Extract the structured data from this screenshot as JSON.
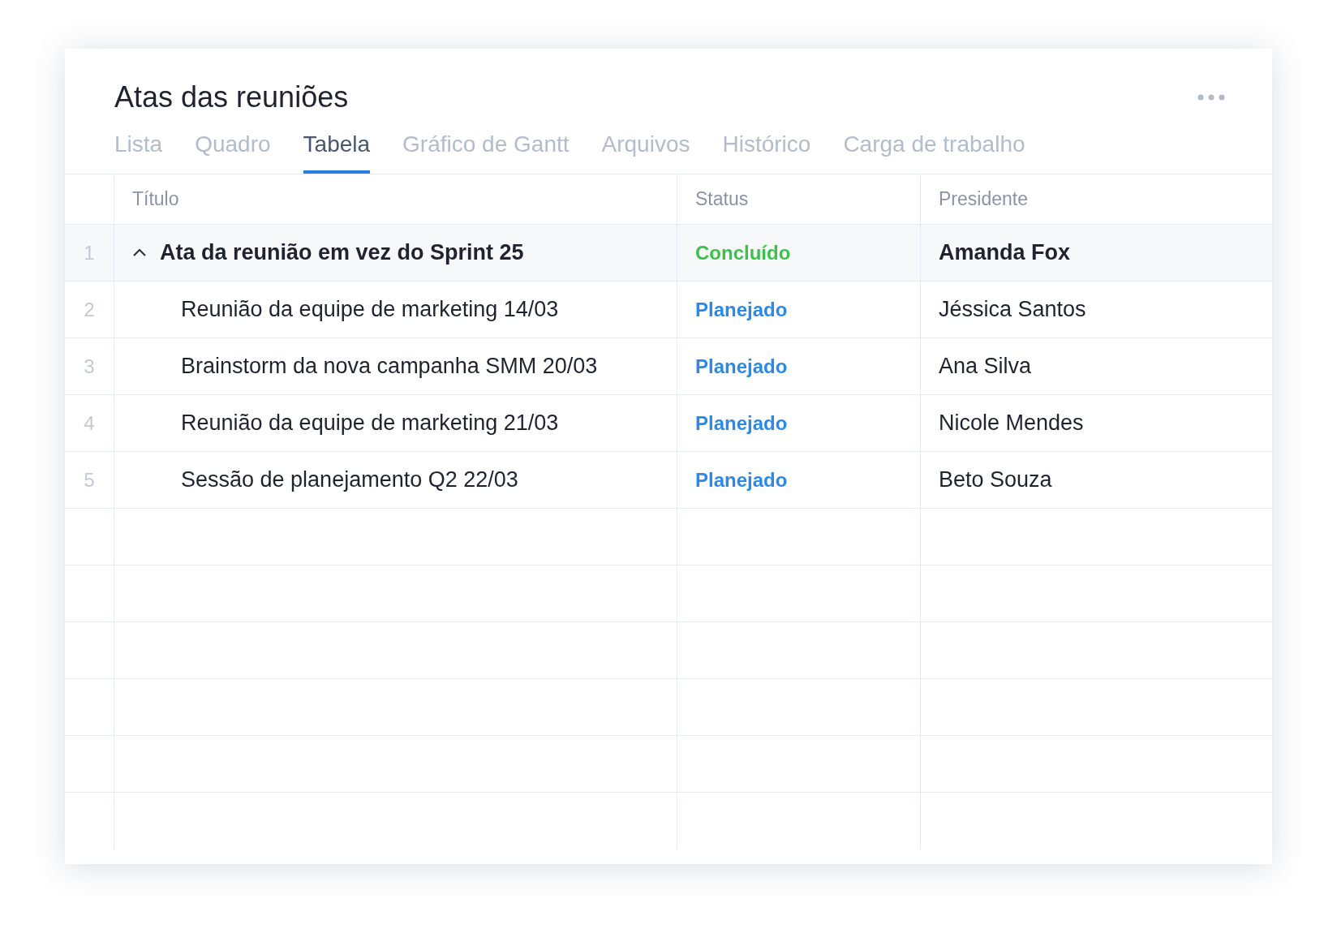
{
  "title": "Atas das reuniões",
  "tabs": [
    {
      "label": "Lista",
      "selected": false
    },
    {
      "label": "Quadro",
      "selected": false
    },
    {
      "label": "Tabela",
      "selected": true
    },
    {
      "label": "Gráfico de Gantt",
      "selected": false
    },
    {
      "label": "Arquivos",
      "selected": false
    },
    {
      "label": "Histórico",
      "selected": false
    },
    {
      "label": "Carga de trabalho",
      "selected": false
    }
  ],
  "table": {
    "columns": [
      "Título",
      "Status",
      "Presidente"
    ],
    "rows": [
      {
        "number": "1",
        "title": "Ata da reunião em vez do Sprint 25",
        "status": "Concluído",
        "color": "#3cc14a",
        "president": "Amanda Fox",
        "expanded": true,
        "children": [
          {
            "number": "2",
            "title": "Reunião da equipe de marketing 14/03",
            "status": "Planejado",
            "color": "#2b8ae8",
            "president": "Jéssica Santos"
          },
          {
            "number": "3",
            "title": "Brainstorm da nova campanha SMM 20/03",
            "status": "Planejado",
            "color": "#2b8ae8",
            "president": "Ana Silva"
          },
          {
            "number": "4",
            "title": "Reunião da equipe de marketing 21/03",
            "status": "Planejado",
            "color": "#2b8ae8",
            "president": "Nicole Mendes"
          },
          {
            "number": "5",
            "title": "Sessão de planejamento Q2 22/03",
            "status": "Planejado",
            "color": "#2b8ae8",
            "president": "Beto Souza"
          }
        ]
      }
    ]
  }
}
